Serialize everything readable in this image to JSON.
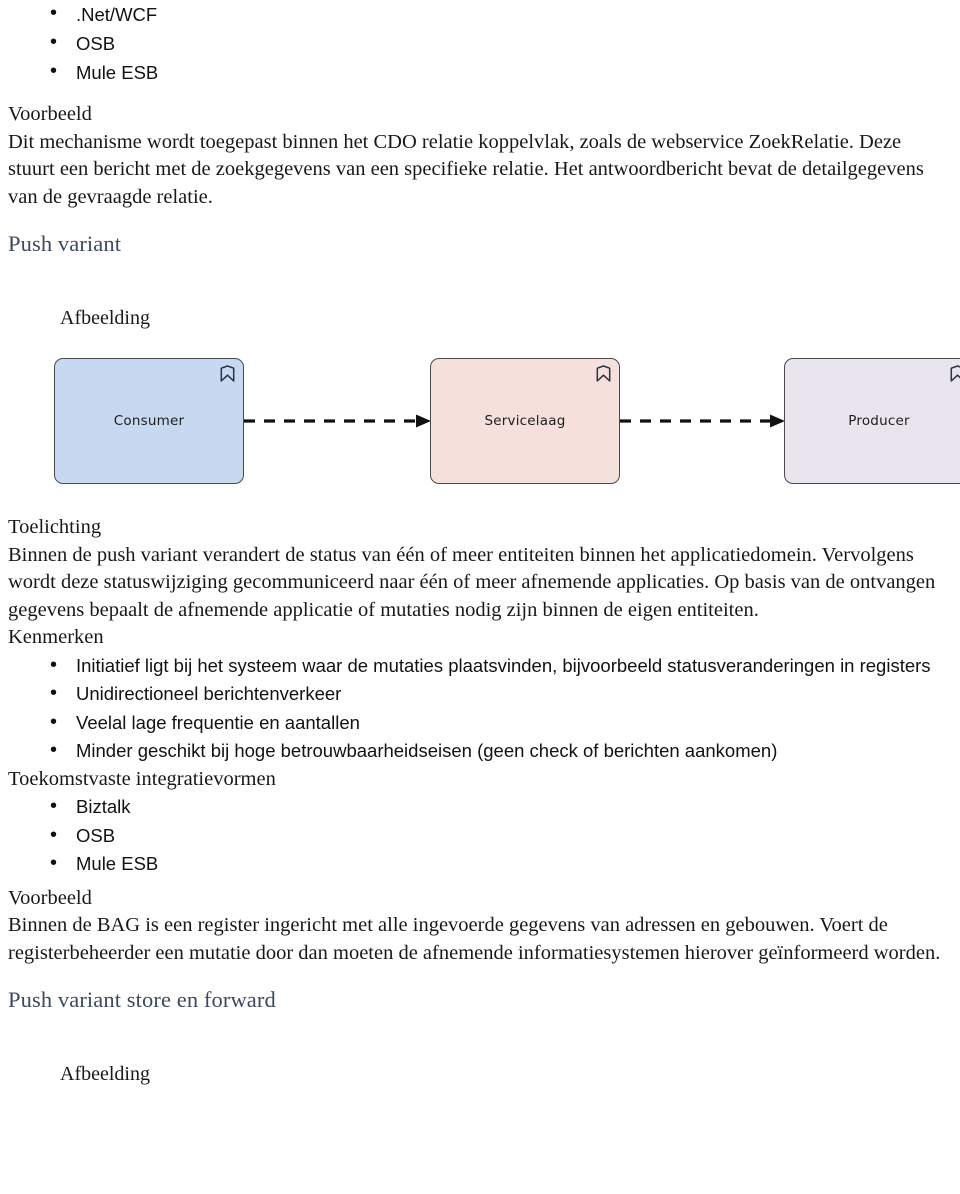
{
  "document": {
    "language": "nl",
    "top_list": {
      "items": [
        ".Net/WCF",
        "OSB",
        "Mule ESB"
      ]
    },
    "sections": [
      {
        "label": "Voorbeeld",
        "body": "Dit mechanisme wordt toegepast binnen het CDO relatie koppelvlak, zoals de webservice ZoekRelatie. Deze stuurt een bericht met de zoekgegevens van een specifieke relatie. Het antwoordbericht bevat de detailgegevens van de gevraagde relatie."
      }
    ],
    "heading_push_variant": "Push variant",
    "afbeelding_label": "Afbeelding",
    "toelichting": {
      "label": "Toelichting",
      "body": "Binnen de push variant verandert de status van één of meer entiteiten binnen het applicatiedomein. Vervolgens wordt deze statuswijziging gecommuniceerd naar één of meer afnemende applicaties. Op basis van de ontvangen gegevens bepaalt de afnemende applicatie of mutaties nodig zijn binnen de eigen entiteiten."
    },
    "kenmerken": {
      "label": "Kenmerken",
      "items": [
        "Initiatief ligt bij het systeem waar de mutaties plaatsvinden, bijvoorbeeld statusveranderingen in registers",
        "Unidirectioneel berichtenverkeer",
        "Veelal lage frequentie en aantallen",
        "Minder geschikt bij hoge betrouwbaarheidseisen (geen check of berichten aankomen)"
      ]
    },
    "toekomstvast": {
      "label": "Toekomstvaste integratievormen",
      "items": [
        "Biztalk",
        "OSB",
        "Mule ESB"
      ]
    },
    "voorbeeld_bag": {
      "label": "Voorbeeld",
      "body": "Binnen de BAG  is een register ingericht met alle ingevoerde gegevens van adressen en gebouwen. Voert de registerbeheerder een mutatie door dan moeten de afnemende informatiesystemen hierover geïnformeerd worden."
    },
    "heading_push_store_forward": "Push variant store en forward",
    "afbeelding_label_bottom": "Afbeelding"
  },
  "diagram": {
    "nodes": [
      {
        "id": "consumer",
        "label": "Consumer",
        "fill": "#c6d9f1",
        "stroke": "#4a4a4a",
        "icon": "application-component-icon"
      },
      {
        "id": "servicelaag",
        "label": "Servicelaag",
        "fill": "#f5e0dc",
        "stroke": "#4a4a4a",
        "icon": "application-component-icon"
      },
      {
        "id": "producer",
        "label": "Producer",
        "fill": "#e8e5ee",
        "stroke": "#4a4a4a",
        "icon": "application-component-icon"
      }
    ],
    "connectors": [
      {
        "from": "consumer",
        "to": "servicelaag",
        "style": "dashed",
        "arrow": "filled-triangle",
        "color": "#111111"
      },
      {
        "from": "servicelaag",
        "to": "producer",
        "style": "dashed",
        "arrow": "filled-triangle",
        "color": "#111111"
      }
    ]
  },
  "colors": {
    "heading_blue": "#3b4a60",
    "body_text": "#181818",
    "page_background": "#ffffff"
  }
}
